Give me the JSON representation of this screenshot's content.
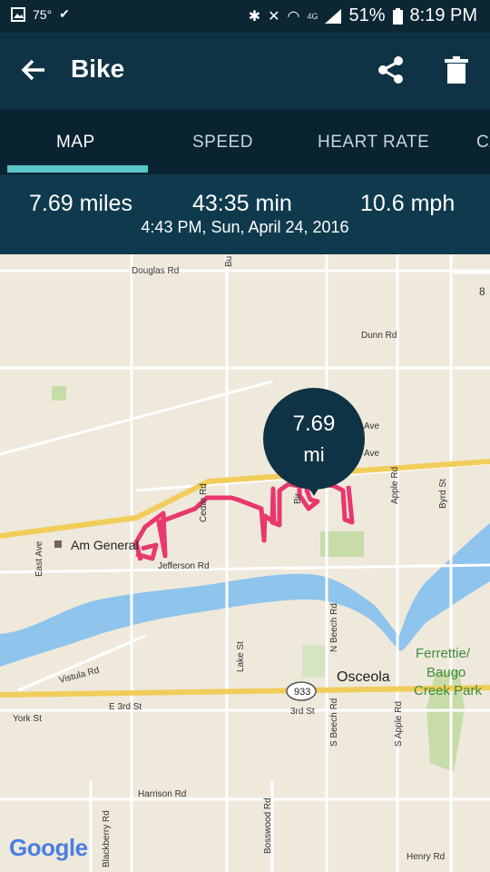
{
  "status_bar": {
    "temperature": "75°",
    "network": "4G",
    "battery": "51%",
    "time": "8:19 PM"
  },
  "app_bar": {
    "title": "Bike",
    "icons": [
      "back-arrow-icon",
      "share-icon",
      "trash-icon"
    ]
  },
  "tabs": [
    {
      "label": "MAP",
      "active": true
    },
    {
      "label": "SPEED",
      "active": false
    },
    {
      "label": "HEART RATE",
      "active": false
    },
    {
      "label": "CA",
      "active": false
    }
  ],
  "summary": {
    "distance": "7.69 miles",
    "duration": "43:35 min",
    "speed": "10.6 mph",
    "datetime": "4:43 PM, Sun, April 24, 2016"
  },
  "map": {
    "marker_value": "7.69",
    "marker_unit": "mi",
    "labels": [
      "Douglas Rd",
      "Dunn Rd",
      "Cedar Rd",
      "Ave",
      "Ave",
      "Apple Rd",
      "Byrd St",
      "Bir",
      "Am General",
      "East Ave",
      "Jefferson Rd",
      "Lake St",
      "N Beech Rd",
      "Osceola",
      "Ferrettie/",
      "Baugo",
      "Creek Park",
      "Vistula Rd",
      "933",
      "E 3rd St",
      "3rd St",
      "York St",
      "S Beech Rd",
      "S Apple Rd",
      "Harrison Rd",
      "Blackberry Rd",
      "Bosswood Rd",
      "Henry Rd",
      "Bu",
      "8"
    ],
    "attribution": "Google",
    "colors": {
      "route": "#e8386e",
      "river": "#8fc4ec",
      "highway": "#f1cd5a",
      "park": "#c7dca8"
    }
  }
}
